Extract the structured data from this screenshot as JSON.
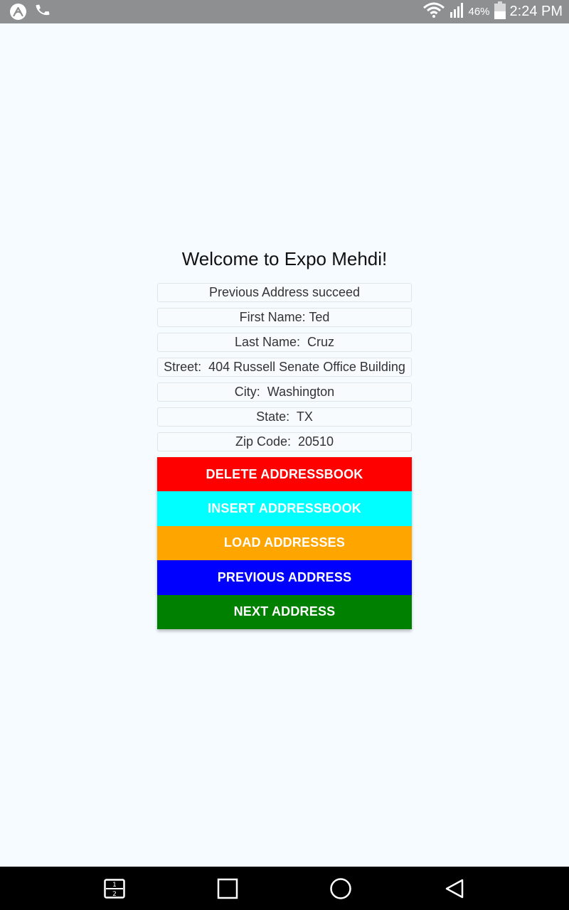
{
  "status_bar": {
    "left_icons": [
      "expo-icon",
      "phone-icon"
    ],
    "right_icons": [
      "wifi-icon",
      "signal-icon",
      "battery-icon"
    ],
    "battery_percent": "46%",
    "time": "2:24 PM"
  },
  "main": {
    "title": "Welcome to Expo Mehdi!",
    "fields": [
      {
        "name": "status",
        "text": "Previous Address succeed"
      },
      {
        "name": "first-name",
        "text": "First Name: Ted"
      },
      {
        "name": "last-name",
        "text": "Last Name:  Cruz"
      },
      {
        "name": "street",
        "text": "Street:  404 Russell Senate Office Building"
      },
      {
        "name": "city",
        "text": "City:  Washington"
      },
      {
        "name": "state",
        "text": "State:  TX"
      },
      {
        "name": "zip-code",
        "text": "Zip Code:  20510"
      }
    ],
    "buttons": [
      {
        "name": "delete-addressbook-button",
        "label": "DELETE ADDRESSBOOK",
        "color": "#ff0000"
      },
      {
        "name": "insert-addressbook-button",
        "label": "INSERT ADDRESSBOOK",
        "color": "#00ffff"
      },
      {
        "name": "load-addresses-button",
        "label": "LOAD ADDRESSES",
        "color": "#ffa500"
      },
      {
        "name": "previous-address-button",
        "label": "PREVIOUS ADDRESS",
        "color": "#0000ff"
      },
      {
        "name": "next-address-button",
        "label": "NEXT ADDRESS",
        "color": "#008000"
      }
    ]
  },
  "nav_bar": {
    "icons": [
      "dual-window-icon",
      "recents-icon",
      "home-icon",
      "back-icon"
    ]
  }
}
